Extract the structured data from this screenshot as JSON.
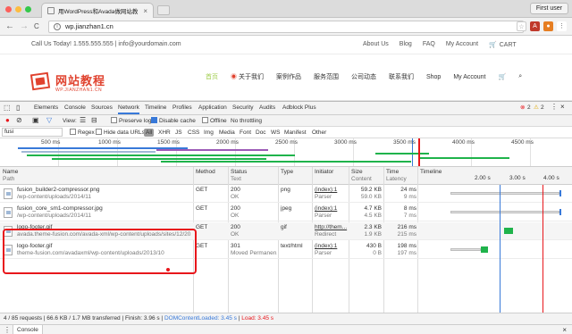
{
  "browser": {
    "tab_title": "用WordPress和Avada做网站教",
    "tab_close": "×",
    "user_button": "First user",
    "url": "wp.jianzhan1.cn",
    "info_icon": "i",
    "back_icon": "←",
    "forward_icon": "→",
    "reload_icon": "C"
  },
  "site": {
    "contact": "Call Us Today! 1.555.555.555 | info@yourdomain.com",
    "top_links": [
      "About Us",
      "Blog",
      "FAQ",
      "My Account"
    ],
    "cart_label": "CART",
    "logo_title": "网站教程",
    "logo_sub": "WP.JIANZHAN1.CN",
    "nav": [
      "首页",
      "关于我们",
      "案例作品",
      "服务范围",
      "公司动态",
      "联系我们",
      "Shop",
      "My Account"
    ]
  },
  "devtools": {
    "tabs": [
      "Elements",
      "Console",
      "Sources",
      "Network",
      "Timeline",
      "Profiles",
      "Application",
      "Security",
      "Audits",
      "Adblock Plus"
    ],
    "selected_tab": "Network",
    "errors": "2",
    "warnings": "2",
    "toolbar": {
      "view_label": "View:",
      "preserve_log": "Preserve log",
      "disable_cache": "Disable cache",
      "offline": "Offline",
      "throttling": "No throttling"
    },
    "filter": {
      "value": "fusi",
      "regex": "Regex",
      "hide_data_urls": "Hide data URLs",
      "types": [
        "All",
        "XHR",
        "JS",
        "CSS",
        "Img",
        "Media",
        "Font",
        "Doc",
        "WS",
        "Manifest",
        "Other"
      ]
    },
    "overview_ticks": [
      "500 ms",
      "1000 ms",
      "1500 ms",
      "2000 ms",
      "2500 ms",
      "3000 ms",
      "3500 ms",
      "4000 ms",
      "4500 ms"
    ],
    "columns": {
      "name": "Name",
      "path": "Path",
      "method": "Method",
      "status": "Status",
      "status_sub": "Text",
      "type": "Type",
      "initiator": "Initiator",
      "size": "Size",
      "size_sub": "Content",
      "time": "Time",
      "time_sub": "Latency",
      "timeline": "Timeline",
      "timeline_ticks": [
        "2.00 s",
        "3.00 s",
        "4.00 s"
      ]
    },
    "rows": [
      {
        "name": "fusion_builder2-compressor.png",
        "path": "/wp-content/uploads/2014/11",
        "method": "GET",
        "status": "200",
        "status_text": "OK",
        "type": "png",
        "initiator": "(index):1",
        "initiator_sub": "Parser",
        "size": "59.2 KB",
        "content": "59.0 KB",
        "time": "24 ms",
        "latency": "9 ms",
        "wf_start": 0.2,
        "wf_end": 0.93,
        "wf_color": "#3879d9"
      },
      {
        "name": "fusion_core_sm1-compressor.jpg",
        "path": "/wp-content/uploads/2014/11",
        "method": "GET",
        "status": "200",
        "status_text": "OK",
        "type": "jpeg",
        "initiator": "(index):1",
        "initiator_sub": "Parser",
        "size": "4.7 KB",
        "content": "4.5 KB",
        "time": "8 ms",
        "latency": "7 ms",
        "wf_start": 0.2,
        "wf_end": 0.93,
        "wf_color": "#3879d9"
      },
      {
        "name": "logo-footer.gif",
        "path": "avada.theme-fusion.com/avada-xml/wp-content/uploads/sites/12/2013...",
        "method": "GET",
        "status": "200",
        "status_text": "OK",
        "type": "gif",
        "initiator": "http://them...",
        "initiator_sub": "Redirect",
        "size": "2.3 KB",
        "content": "1.9 KB",
        "time": "216 ms",
        "latency": "215 ms",
        "wf_start": 0.56,
        "wf_end": 0.62,
        "wf_color": "#1fb34b"
      },
      {
        "name": "logo-footer.gif",
        "path": "theme-fusion.com/avadaxml/wp-content/uploads/2013/10",
        "method": "GET",
        "status": "301",
        "status_text": "Moved Permanen...",
        "type": "text/html",
        "initiator": "(index):1",
        "initiator_sub": "Parser",
        "size": "430 B",
        "content": "0 B",
        "time": "198 ms",
        "latency": "197 ms",
        "wf_start": 0.2,
        "wf_end": 0.45,
        "wf_color": "#1fb34b"
      }
    ],
    "status_bar": {
      "summary": "4 / 85 requests | 66.6 KB / 1.7 MB transferred | Finish: 3.96 s |",
      "dom_content_loaded": "DOMContentLoaded: 3.45 s",
      "separator": "|",
      "load": "Load: 3.45 s"
    },
    "console_tab": "Console",
    "colors": {
      "accent": "#3879d9",
      "load": "#e8161b",
      "dcl": "#3879d9",
      "green": "#1fb34b"
    }
  }
}
